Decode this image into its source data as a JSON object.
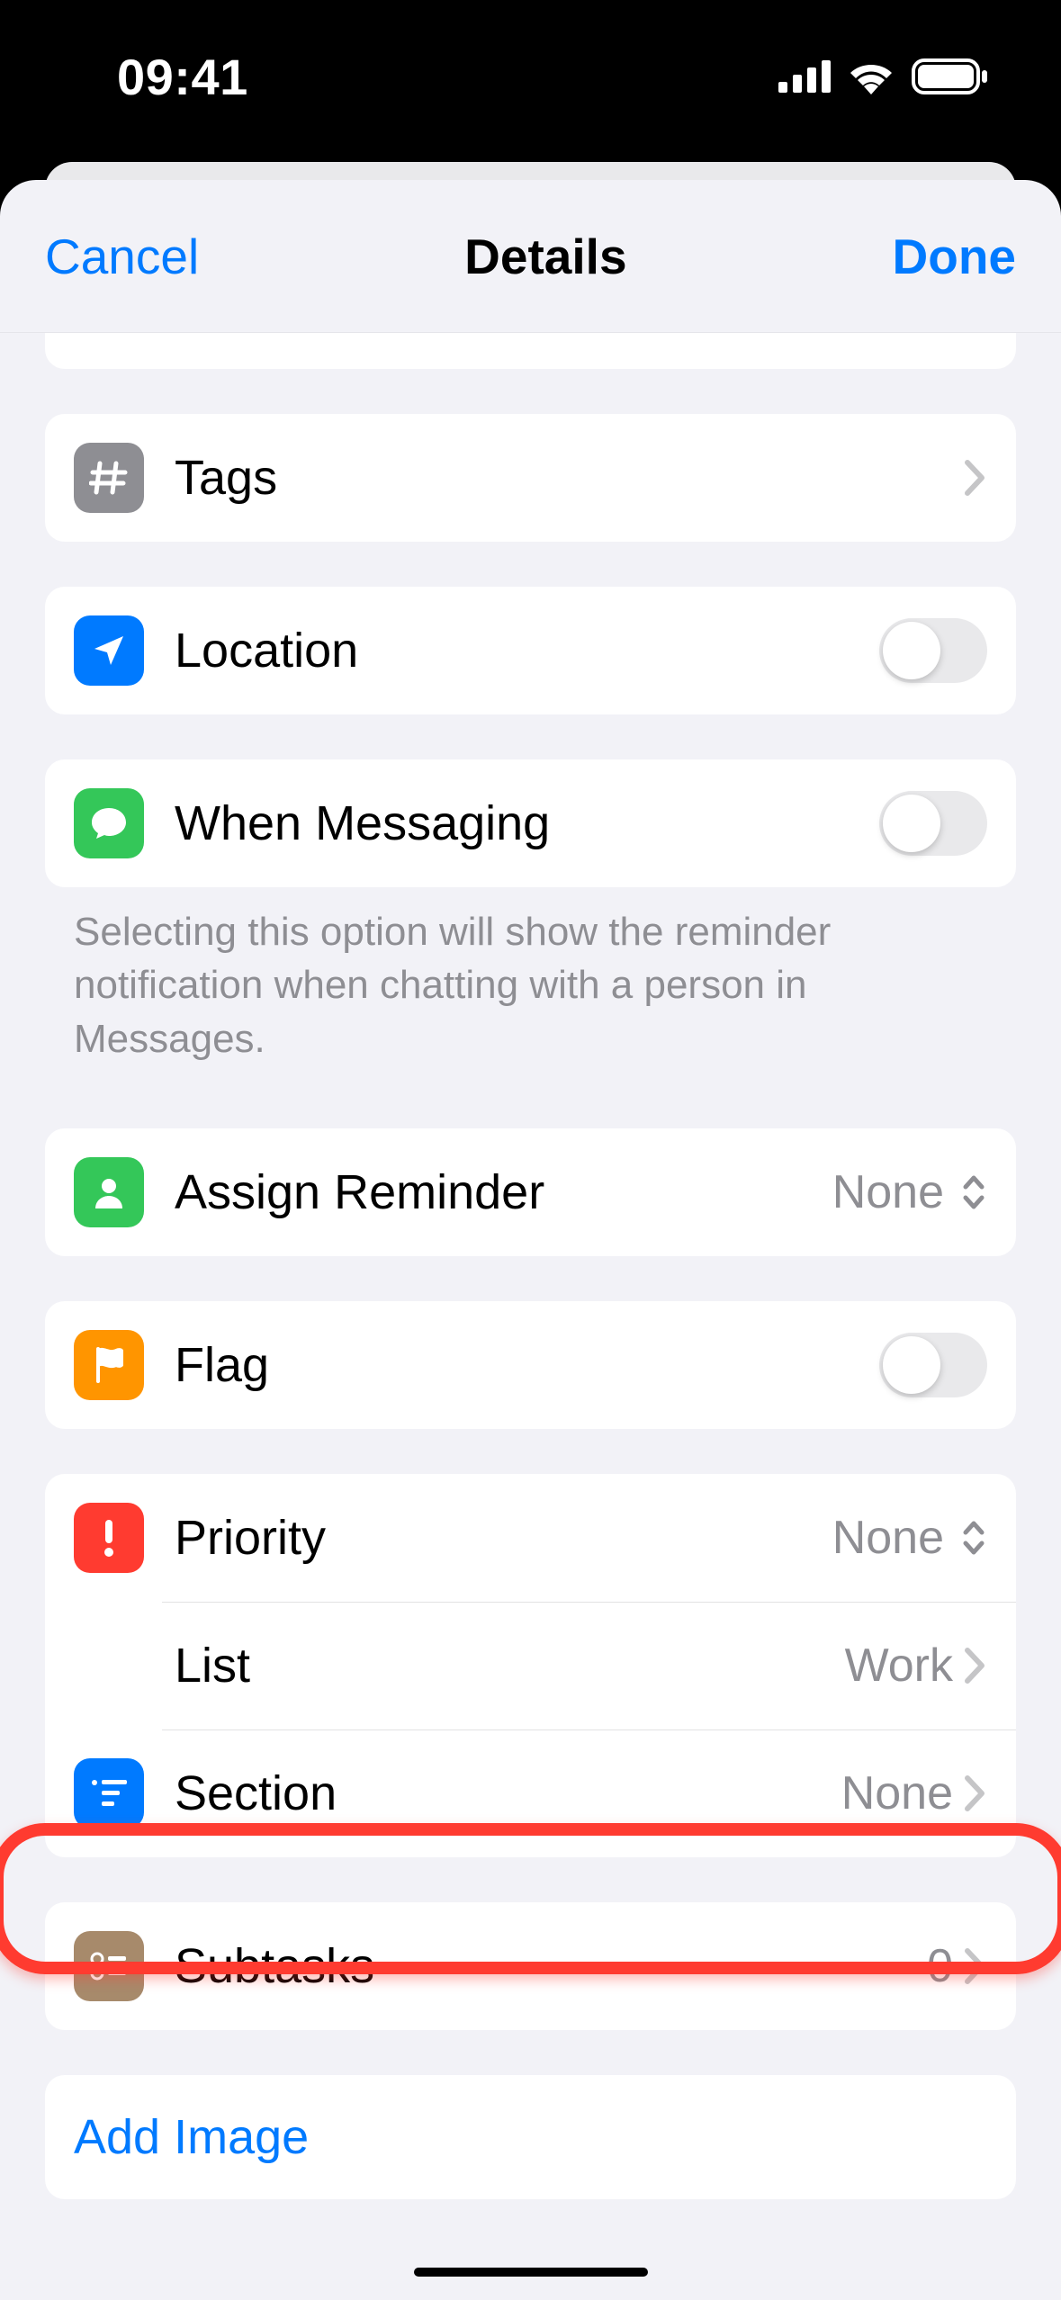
{
  "status": {
    "time": "09:41"
  },
  "header": {
    "cancel": "Cancel",
    "title": "Details",
    "done": "Done"
  },
  "rows": {
    "tags": {
      "label": "Tags"
    },
    "location": {
      "label": "Location"
    },
    "messaging": {
      "label": "When Messaging"
    },
    "assign": {
      "label": "Assign Reminder",
      "value": "None"
    },
    "flag": {
      "label": "Flag"
    },
    "priority": {
      "label": "Priority",
      "value": "None"
    },
    "list": {
      "label": "List",
      "value": "Work"
    },
    "section": {
      "label": "Section",
      "value": "None"
    },
    "subtasks": {
      "label": "Subtasks",
      "value": "0"
    }
  },
  "footer": {
    "messaging": "Selecting this option will show the reminder notification when chatting with a person in Messages."
  },
  "actions": {
    "addImage": "Add Image"
  },
  "icons": {
    "tags_bg": "#8e8e93",
    "location_bg": "#007aff",
    "messaging_bg": "#34c759",
    "assign_bg": "#34c759",
    "flag_bg": "#ff9500",
    "priority_bg": "#ff3b30",
    "list_bg": "#d2a8a0",
    "section_bg": "#007aff",
    "subtasks_bg": "#a78a6b"
  }
}
